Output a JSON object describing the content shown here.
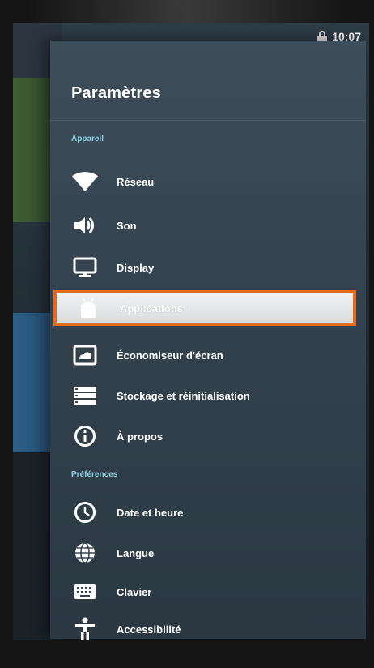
{
  "status": {
    "time": "10:07"
  },
  "panel": {
    "title": "Paramètres"
  },
  "sections": {
    "device": "Appareil",
    "preferences": "Préférences"
  },
  "items": [
    {
      "label": "Réseau",
      "icon": "wifi-icon"
    },
    {
      "label": "Son",
      "icon": "speaker-icon"
    },
    {
      "label": "Display",
      "icon": "monitor-icon"
    },
    {
      "label": "Applications",
      "icon": "android-icon"
    },
    {
      "label": "Économiseur d'écran",
      "icon": "screensaver-icon"
    },
    {
      "label": "Stockage et réinitialisation",
      "icon": "storage-icon"
    },
    {
      "label": "À propos",
      "icon": "info-icon"
    },
    {
      "label": "Date et heure",
      "icon": "clock-icon"
    },
    {
      "label": "Langue",
      "icon": "globe-icon"
    },
    {
      "label": "Clavier",
      "icon": "keyboard-icon"
    },
    {
      "label": "Accessibilité",
      "icon": "accessibility-icon"
    }
  ],
  "colors": {
    "selection_border": "#e76a1c",
    "section_header": "#8ad0e0"
  }
}
